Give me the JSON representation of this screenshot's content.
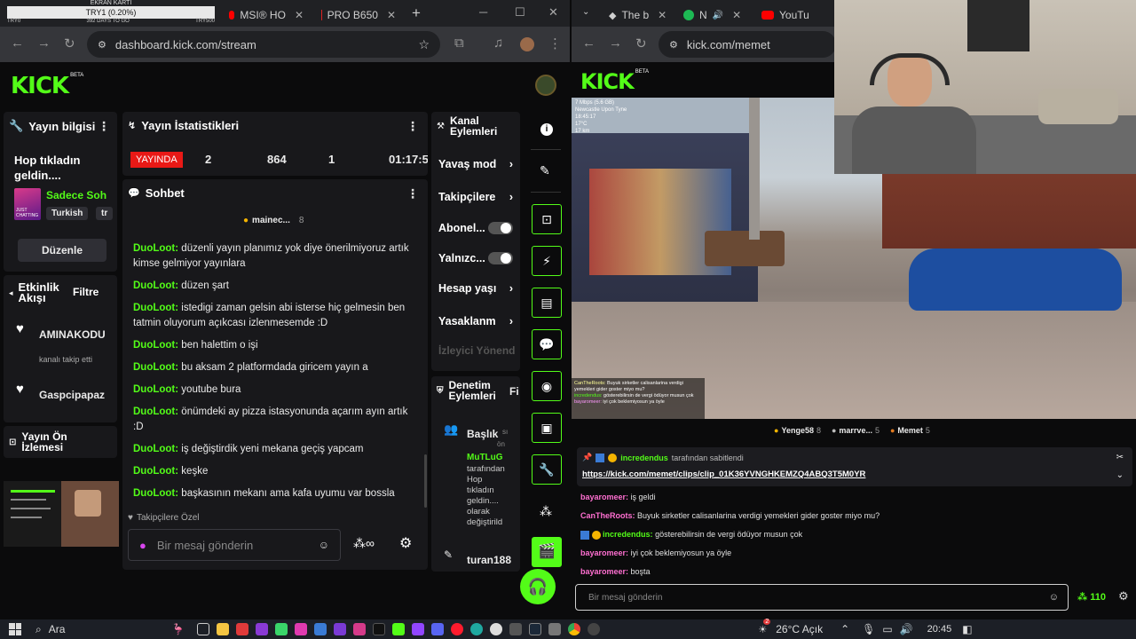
{
  "ticker": {
    "title": "EKRAN KARTI",
    "value": "TRY1 (0.20%)",
    "left": "TRY0",
    "mid": "392 DAYS TO GO",
    "right": "TRY500"
  },
  "left_browser": {
    "tabs": [
      {
        "label": "MSI® HO",
        "icon": "youtube-icon"
      },
      {
        "label": "PRO B650",
        "icon": "shield-icon"
      }
    ],
    "url": "dashboard.kick.com/stream",
    "logo": "KICK",
    "logo_badge": "BETA"
  },
  "stream_info": {
    "title": "Yayın bilgisi",
    "stream_title": "Hop tıkladın geldin....",
    "category_name": "Sadece Soh",
    "thumb_label": "JUST CHATTING",
    "tags": [
      "Turkish",
      "tr"
    ],
    "edit_button": "Düzenle"
  },
  "activity": {
    "title": "Etkinlik Akışı",
    "filter": "Filtre",
    "items": [
      {
        "name": "AMINAKODU",
        "sub": "kanalı takip etti"
      },
      {
        "name": "Gaspcipapaz",
        "sub": ""
      }
    ]
  },
  "preview": {
    "title": "Yayın Ön İzlemesi"
  },
  "stats": {
    "title": "Yayın İstatistikleri",
    "live_badge": "YAYINDA",
    "values": [
      "2",
      "864",
      "1",
      "01:17:5"
    ]
  },
  "chat": {
    "title": "Sohbet",
    "pinned_user": "mainec...",
    "pinned_count": "8",
    "messages": [
      {
        "user": "DuoLoot:",
        "text": "düzenli yayın planımız yok diye önerilmiyoruz artık kimse gelmiyor yayınlara"
      },
      {
        "user": "DuoLoot:",
        "text": "düzen şart"
      },
      {
        "user": "DuoLoot:",
        "text": "istedigi zaman gelsin abi isterse hiç gelmesin ben tatmin oluyorum açıkcası izlenmesemde :D"
      },
      {
        "user": "DuoLoot:",
        "text": "ben halettim o işi"
      },
      {
        "user": "DuoLoot:",
        "text": "bu aksam 2 platformdada giricem yayın a"
      },
      {
        "user": "DuoLoot:",
        "text": "youtube bura"
      },
      {
        "user": "DuoLoot:",
        "text": "önümdeki ay pizza istasyonunda açarım ayın artık :D"
      },
      {
        "user": "DuoLoot:",
        "text": "iş değiştirdik yeni mekana geçiş yapcam"
      },
      {
        "user": "DuoLoot:",
        "text": "keşke"
      },
      {
        "user": "DuoLoot:",
        "text": "başkasının mekanı ama kafa uyumu var bossla"
      }
    ],
    "followers_only": "Takipçilere Özel",
    "input_placeholder": "Bir mesaj gönderin"
  },
  "channel_actions": {
    "title": "Kanal Eylemleri",
    "items": [
      {
        "label": "Yavaş mod",
        "kind": "arrow"
      },
      {
        "label": "Takipçilere",
        "kind": "arrow"
      },
      {
        "label": "Abonel...",
        "kind": "toggle"
      },
      {
        "label": "Yalnızc...",
        "kind": "toggle"
      },
      {
        "label": "Hesap yaşı",
        "kind": "arrow"
      },
      {
        "label": "Yasaklanm",
        "kind": "arrow"
      }
    ],
    "disabled_item": "İzleyici Yönend"
  },
  "mod_actions": {
    "title": "Denetim Eylemleri",
    "filter": "Fi",
    "heading_label": "Başlık",
    "heading_meta": "sı",
    "heading_meta2": "ön",
    "mod_user": "MuTLuG",
    "mod_text": "tarafından Hop tıkladın geldin.... olarak değiştirild",
    "last_user": "turan188"
  },
  "right_browser": {
    "tabs": [
      {
        "label": "The b",
        "icon": "diamond-icon"
      },
      {
        "label": "N",
        "icon": "spotify-icon"
      },
      {
        "label": "YouTu",
        "icon": "youtube-icon"
      }
    ],
    "url": "kick.com/memet",
    "logo": "KICK",
    "logo_badge": "BETA"
  },
  "video": {
    "overlay_lines": [
      "7 Mbps (5.6 GB)",
      "Newcastle Upon Tyne",
      "18:45:17",
      "17°C",
      "17 km"
    ],
    "overlay_chat": [
      {
        "user": "CanTheRoots:",
        "text": "Buyuk sirketler calisanlarina verdigi yemekleri gider goster miyo mu?"
      },
      {
        "user": "incredendus:",
        "text": "gösterebilirsin de vergi ödüyor musun çok"
      },
      {
        "user": "bayaromeer:",
        "text": "iyi çok beklemiyosun ya öyle"
      }
    ]
  },
  "viewer_chat": {
    "top_users": [
      {
        "name": "Yenge58",
        "count": "8"
      },
      {
        "name": "marrve...",
        "count": "5"
      },
      {
        "name": "Memet",
        "count": "5"
      }
    ],
    "pinned_by_user": "incredendus",
    "pinned_by_text": "tarafından sabitlendi",
    "pinned_link": "https://kick.com/memet/clips/clip_01K36YVNGHKEMZQ4ABQ3T5M0YR",
    "messages": [
      {
        "user": "bayaromeer:",
        "text": "iş geldi",
        "color": "#ff6fd1"
      },
      {
        "user": "CanTheRoots:",
        "text": "Buyuk sirketler calisanlarina verdigi yemekleri gider goster miyo mu?",
        "color": "#ff6fd1"
      },
      {
        "user": "incredendus:",
        "text": "gösterebilirsin de vergi ödüyor musun çok",
        "color": "#53fc18"
      },
      {
        "user": "bayaromeer:",
        "text": "iyi çok beklemiyosun ya öyle",
        "color": "#ff6fd1"
      },
      {
        "user": "bayaromeer:",
        "text": "boşta",
        "color": "#ff6fd1"
      }
    ],
    "input_placeholder": "Bir mesaj gönderin",
    "points": "110"
  },
  "taskbar": {
    "search": "Ara",
    "weather": "26°C Açık",
    "weather_badge": "2",
    "time": "20:45"
  },
  "colors": {
    "kick_green": "#53fc18",
    "live_red": "#e91916",
    "panel": "#18181b"
  }
}
